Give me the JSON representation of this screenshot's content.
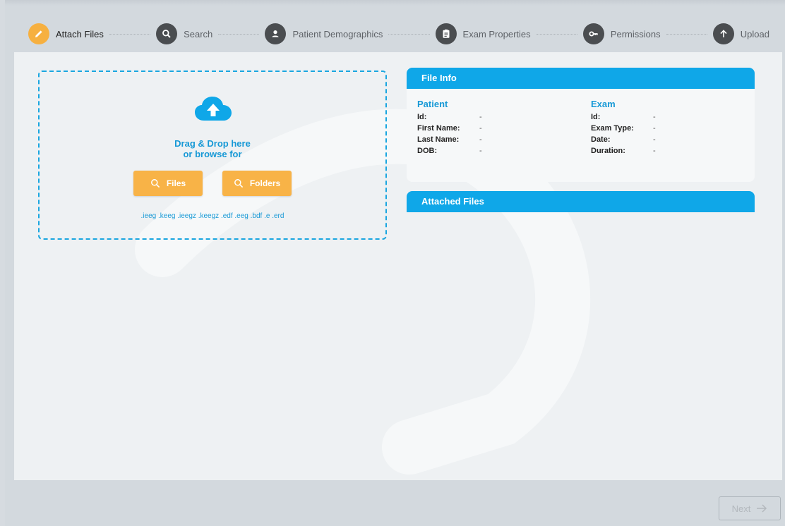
{
  "stepper": {
    "steps": [
      {
        "label": "Attach Files",
        "icon": "pencil-icon",
        "active": true
      },
      {
        "label": "Search",
        "icon": "search-icon",
        "active": false
      },
      {
        "label": "Patient Demographics",
        "icon": "person-icon",
        "active": false
      },
      {
        "label": "Exam Properties",
        "icon": "clipboard-icon",
        "active": false
      },
      {
        "label": "Permissions",
        "icon": "key-icon",
        "active": false
      },
      {
        "label": "Upload",
        "icon": "arrow-up-icon",
        "active": false
      }
    ]
  },
  "dropzone": {
    "line1": "Drag & Drop here",
    "line2": "or browse for",
    "files_label": "Files",
    "folders_label": "Folders",
    "extensions": ".ieeg .keeg .ieegz .keegz .edf .eeg .bdf .e .erd"
  },
  "file_info": {
    "title": "File Info",
    "patient": {
      "title": "Patient",
      "rows": [
        {
          "key": "Id:",
          "value": "-"
        },
        {
          "key": "First Name:",
          "value": "-"
        },
        {
          "key": "Last Name:",
          "value": "-"
        },
        {
          "key": "DOB:",
          "value": "-"
        }
      ]
    },
    "exam": {
      "title": "Exam",
      "rows": [
        {
          "key": "Id:",
          "value": "-"
        },
        {
          "key": "Exam Type:",
          "value": "-"
        },
        {
          "key": "Date:",
          "value": "-"
        },
        {
          "key": "Duration:",
          "value": "-"
        }
      ]
    }
  },
  "attached_files": {
    "title": "Attached Files"
  },
  "footer": {
    "next_label": "Next"
  },
  "colors": {
    "accent": "#0fa7e8",
    "button": "#f8b347",
    "active_step": "#f6b040",
    "inactive_step": "#4a4d50"
  }
}
